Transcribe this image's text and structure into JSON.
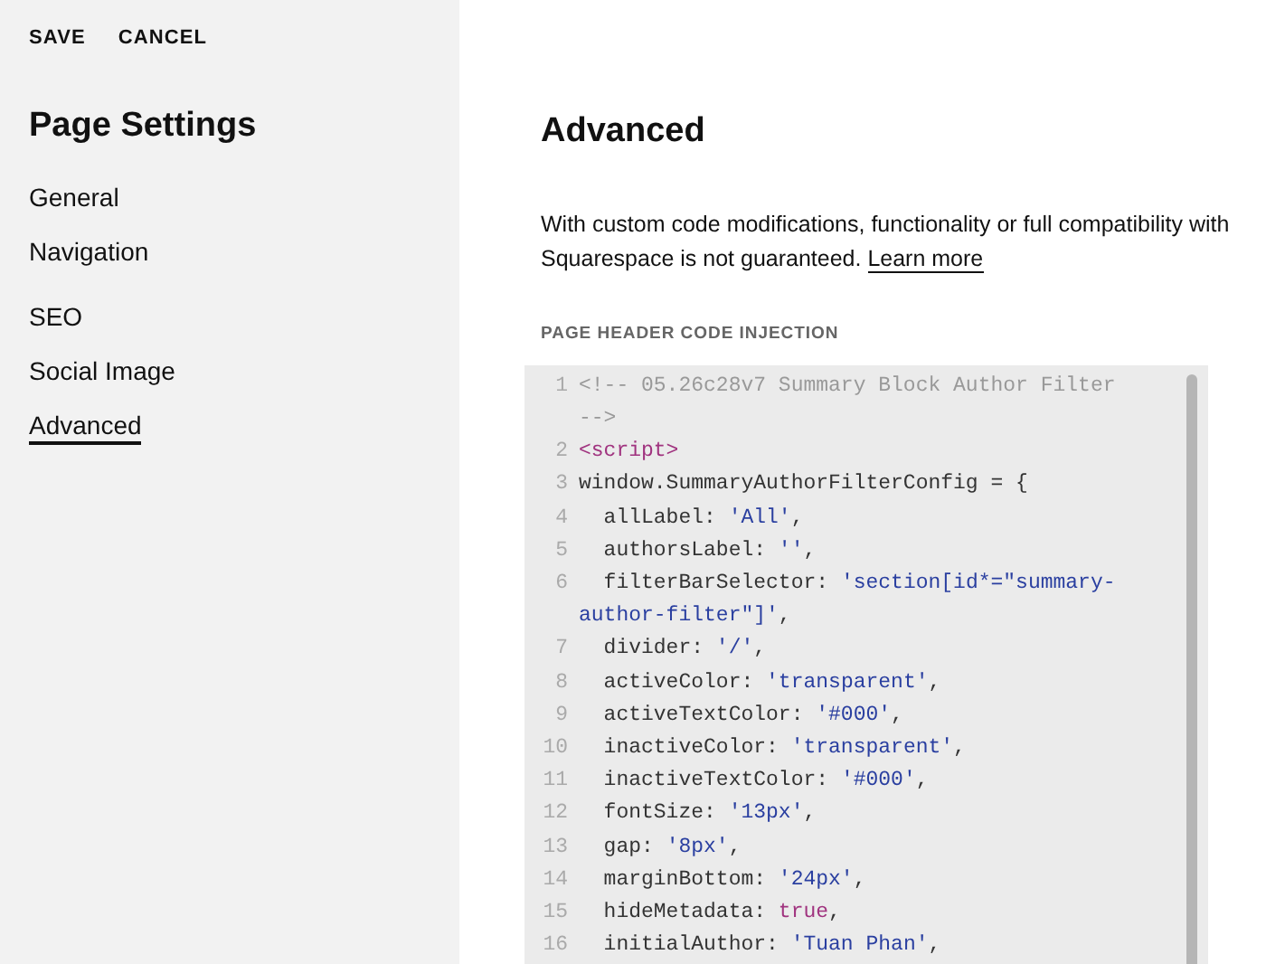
{
  "sidebar": {
    "actions": [
      "SAVE",
      "CANCEL"
    ],
    "title": "Page Settings",
    "groups": [
      [
        {
          "label": "General",
          "selected": false
        },
        {
          "label": "Navigation",
          "selected": false
        }
      ],
      [
        {
          "label": "SEO",
          "selected": false
        },
        {
          "label": "Social Image",
          "selected": false
        },
        {
          "label": "Advanced",
          "selected": true
        }
      ]
    ]
  },
  "main": {
    "title": "Advanced",
    "description": "With custom code modifications, functionality or full compatibility with Squarespace is not guaranteed.",
    "link": "Learn more",
    "section_label": "PAGE HEADER CODE INJECTION",
    "code_lines": [
      {
        "number": "1",
        "rows": [
          {
            "tokens": [
              {
                "kind": "comment",
                "text": "<!-- 05.26c28v7 Summary Block Author Filter"
              }
            ]
          },
          {
            "tokens": [
              {
                "kind": "comment",
                "text": "-->"
              }
            ]
          }
        ]
      },
      {
        "number": "2",
        "rows": [
          {
            "tokens": [
              {
                "kind": "tag",
                "text": "<script>"
              }
            ]
          }
        ]
      },
      {
        "number": "3",
        "rows": [
          {
            "tokens": [
              {
                "kind": "plain",
                "text": "window.SummaryAuthorFilterConfig = {"
              }
            ]
          }
        ]
      },
      {
        "number": "4",
        "rows": [
          {
            "tokens": [
              {
                "kind": "plain",
                "text": "  allLabel: "
              },
              {
                "kind": "string",
                "text": "'All'"
              },
              {
                "kind": "plain",
                "text": ","
              }
            ]
          }
        ]
      },
      {
        "number": "5",
        "rows": [
          {
            "tokens": [
              {
                "kind": "plain",
                "text": "  authorsLabel: "
              },
              {
                "kind": "string",
                "text": "''"
              },
              {
                "kind": "plain",
                "text": ","
              }
            ]
          }
        ]
      },
      {
        "number": "6",
        "rows": [
          {
            "tokens": [
              {
                "kind": "plain",
                "text": "  filterBarSelector: "
              },
              {
                "kind": "string",
                "text": "'section[id*=\"summary-"
              }
            ]
          },
          {
            "tokens": [
              {
                "kind": "string",
                "text": "author-filter\"]'"
              },
              {
                "kind": "plain",
                "text": ","
              }
            ]
          }
        ]
      },
      {
        "number": "7",
        "rows": [
          {
            "tokens": [
              {
                "kind": "plain",
                "text": "  divider: "
              },
              {
                "kind": "string",
                "text": "'/'"
              },
              {
                "kind": "plain",
                "text": ","
              }
            ]
          }
        ]
      },
      {
        "number": "8",
        "rows": [
          {
            "tokens": [
              {
                "kind": "plain",
                "text": "  activeColor: "
              },
              {
                "kind": "string",
                "text": "'transparent'"
              },
              {
                "kind": "plain",
                "text": ","
              }
            ]
          }
        ]
      },
      {
        "number": "9",
        "rows": [
          {
            "tokens": [
              {
                "kind": "plain",
                "text": "  activeTextColor: "
              },
              {
                "kind": "string",
                "text": "'#000'"
              },
              {
                "kind": "plain",
                "text": ","
              }
            ]
          }
        ]
      },
      {
        "number": "10",
        "rows": [
          {
            "tokens": [
              {
                "kind": "plain",
                "text": "  inactiveColor: "
              },
              {
                "kind": "string",
                "text": "'transparent'"
              },
              {
                "kind": "plain",
                "text": ","
              }
            ]
          }
        ]
      },
      {
        "number": "11",
        "rows": [
          {
            "tokens": [
              {
                "kind": "plain",
                "text": "  inactiveTextColor: "
              },
              {
                "kind": "string",
                "text": "'#000'"
              },
              {
                "kind": "plain",
                "text": ","
              }
            ]
          }
        ]
      },
      {
        "number": "12",
        "rows": [
          {
            "tokens": [
              {
                "kind": "plain",
                "text": "  fontSize: "
              },
              {
                "kind": "string",
                "text": "'13px'"
              },
              {
                "kind": "plain",
                "text": ","
              }
            ]
          }
        ]
      },
      {
        "number": "13",
        "rows": [
          {
            "tokens": [
              {
                "kind": "plain",
                "text": "  gap: "
              },
              {
                "kind": "string",
                "text": "'8px'"
              },
              {
                "kind": "plain",
                "text": ","
              }
            ]
          }
        ]
      },
      {
        "number": "14",
        "rows": [
          {
            "tokens": [
              {
                "kind": "plain",
                "text": "  marginBottom: "
              },
              {
                "kind": "string",
                "text": "'24px'"
              },
              {
                "kind": "plain",
                "text": ","
              }
            ]
          }
        ]
      },
      {
        "number": "15",
        "rows": [
          {
            "tokens": [
              {
                "kind": "plain",
                "text": "  hideMetadata: "
              },
              {
                "kind": "keyword",
                "text": "true"
              },
              {
                "kind": "plain",
                "text": ","
              }
            ]
          }
        ]
      },
      {
        "number": "16",
        "rows": [
          {
            "tokens": [
              {
                "kind": "plain",
                "text": "  initialAuthor: "
              },
              {
                "kind": "string",
                "text": "'Tuan Phan'"
              },
              {
                "kind": "plain",
                "text": ","
              }
            ]
          }
        ]
      }
    ]
  }
}
